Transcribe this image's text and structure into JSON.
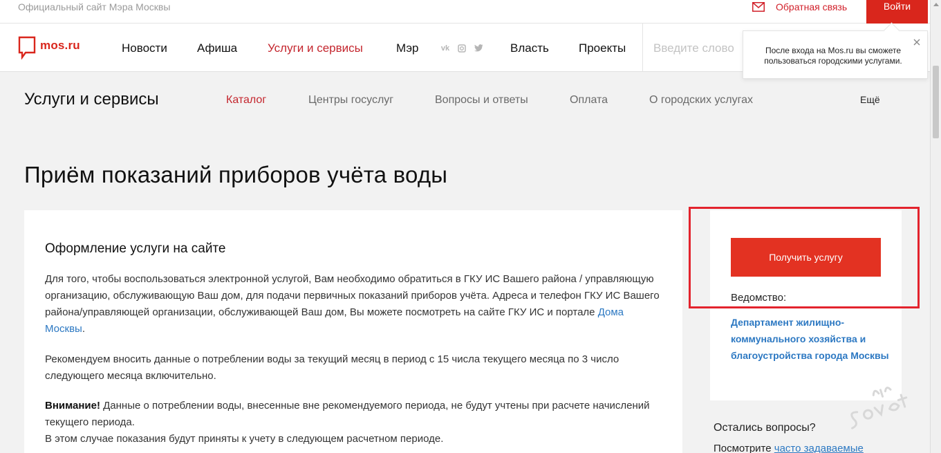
{
  "topbar": {
    "official_text": "Официальный сайт Мэра Москвы",
    "feedback_label": "Обратная связь",
    "login_label": "Войти"
  },
  "header": {
    "logo_text": "mos.ru",
    "nav": [
      {
        "label": "Новости",
        "active": false
      },
      {
        "label": "Афиша",
        "active": false
      },
      {
        "label": "Услуги и сервисы",
        "active": true
      },
      {
        "label": "Мэр",
        "active": false
      },
      {
        "label": "Власть",
        "active": false
      },
      {
        "label": "Проекты",
        "active": false
      }
    ],
    "socials": [
      "vk-icon",
      "instagram-icon",
      "twitter-icon"
    ],
    "search_placeholder": "Введите слово"
  },
  "tooltip": {
    "text": "После входа на Mos.ru вы сможете пользоваться городскими услугами."
  },
  "subnav": {
    "title": "Услуги и сервисы",
    "items": [
      {
        "label": "Каталог",
        "active": true
      },
      {
        "label": "Центры госуслуг",
        "active": false
      },
      {
        "label": "Вопросы и ответы",
        "active": false
      },
      {
        "label": "Оплата",
        "active": false
      },
      {
        "label": "О городских услугах",
        "active": false
      }
    ],
    "more_label": "Ещё"
  },
  "page": {
    "title": "Приём показаний приборов учёта воды"
  },
  "card": {
    "heading": "Оформление услуги на сайте",
    "p1_text": "Для того, чтобы воспользоваться электронной услугой, Вам необходимо обратиться в ГКУ ИС Вашего района / управляющую организацию, обслуживающую Ваш дом, для подачи первичных показаний приборов учёта. Адреса и телефон ГКУ ИС Вашего района/управляющей организации, обслуживающей Ваш дом, Вы можете посмотреть на сайте ГКУ ИС и портале ",
    "p1_link": "Дома Москвы",
    "p1_end": ".",
    "p2_text": "Рекомендуем вносить данные о потреблении воды за текущий месяц в период с 15 числа текущего месяца по 3 число следующего месяца включительно.",
    "p3_bold": "Внимание!",
    "p3_text": " Данные о потреблении воды, внесенные вне рекомендуемого периода, не будут учтены при расчете начислений текущего периода.",
    "p3_line2": "В этом случае показания будут приняты к учету в следующем расчетном периоде."
  },
  "side": {
    "button_label": "Получить услугу",
    "dept_label": "Ведомство:",
    "dept_link": "Департамент жилищно-коммунального хозяйства и благоустройства города Москвы",
    "questions_title": "Остались вопросы?",
    "questions_prefix": "Посмотрите ",
    "questions_link": "часто задаваемые"
  },
  "colors": {
    "brand_red": "#d9261c",
    "link_blue": "#2c78c2",
    "highlight_red": "#e3232d"
  }
}
